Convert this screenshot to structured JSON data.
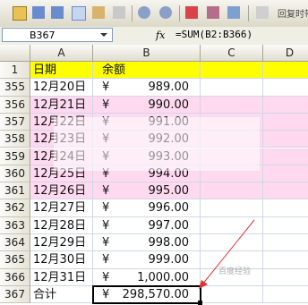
{
  "toolbar": {
    "text": "回复时带"
  },
  "formula_bar": {
    "name_box": "B367",
    "fx": "fx",
    "formula": "=SUM(B2:B366)"
  },
  "columns": [
    "A",
    "B",
    "C",
    "D"
  ],
  "rows": [
    {
      "num": "1",
      "a": "日期",
      "b_yen": "",
      "b_amt": "余额",
      "header": true
    },
    {
      "num": "355",
      "a": "12月20日",
      "b_yen": "¥",
      "b_amt": "989.00"
    },
    {
      "num": "356",
      "a": "12月21日",
      "b_yen": "¥",
      "b_amt": "990.00"
    },
    {
      "num": "357",
      "a": "12月22日",
      "b_yen": "¥",
      "b_amt": "991.00"
    },
    {
      "num": "358",
      "a": "12月23日",
      "b_yen": "¥",
      "b_amt": "992.00"
    },
    {
      "num": "359",
      "a": "12月24日",
      "b_yen": "¥",
      "b_amt": "993.00"
    },
    {
      "num": "360",
      "a": "12月25日",
      "b_yen": "¥",
      "b_amt": "994.00"
    },
    {
      "num": "361",
      "a": "12月26日",
      "b_yen": "¥",
      "b_amt": "995.00"
    },
    {
      "num": "362",
      "a": "12月27日",
      "b_yen": "¥",
      "b_amt": "996.00"
    },
    {
      "num": "363",
      "a": "12月28日",
      "b_yen": "¥",
      "b_amt": "997.00"
    },
    {
      "num": "364",
      "a": "12月29日",
      "b_yen": "¥",
      "b_amt": "998.00"
    },
    {
      "num": "365",
      "a": "12月30日",
      "b_yen": "¥",
      "b_amt": "999.00"
    },
    {
      "num": "366",
      "a": "12月31日",
      "b_yen": "¥",
      "b_amt": "1,000.00"
    },
    {
      "num": "367",
      "a": "合计",
      "b_yen": "¥",
      "b_amt": "298,570.00"
    }
  ],
  "colors": {
    "header_fill": "#ffff00",
    "row_fill": "#ffd9f0"
  },
  "watermark": "百度经验"
}
